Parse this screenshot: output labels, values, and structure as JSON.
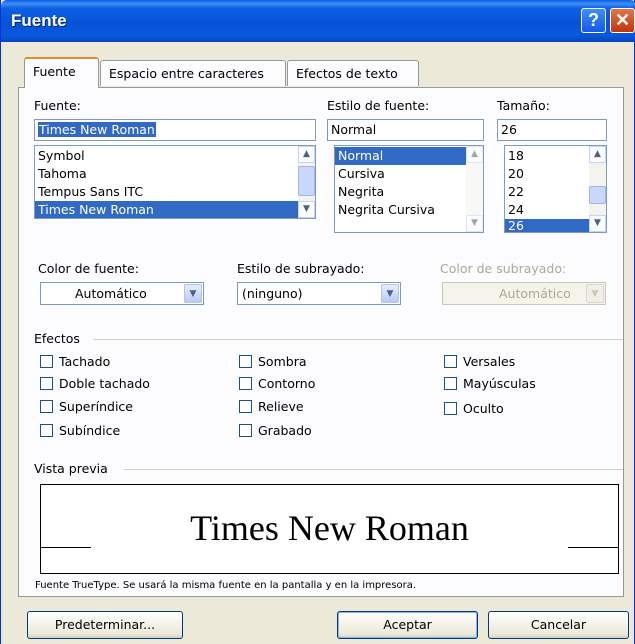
{
  "window": {
    "title": "Fuente",
    "help_glyph": "?",
    "close_glyph": "✕"
  },
  "tabs": [
    {
      "label": "Fuente",
      "selected": true
    },
    {
      "label": "Espacio entre caracteres",
      "selected": false
    },
    {
      "label": "Efectos de texto",
      "selected": false
    }
  ],
  "font": {
    "label": "Fuente:",
    "value": "Times New Roman",
    "items": [
      "Symbol",
      "Tahoma",
      "Tempus Sans ITC",
      "Times New Roman"
    ],
    "selected": "Times New Roman"
  },
  "style": {
    "label": "Estilo de fuente:",
    "value": "Normal",
    "items": [
      "Normal",
      "Cursiva",
      "Negrita",
      "Negrita Cursiva"
    ],
    "selected": "Normal"
  },
  "size": {
    "label": "Tamaño:",
    "value": "26",
    "items": [
      "18",
      "20",
      "22",
      "24",
      "26"
    ],
    "selected": "26"
  },
  "font_color": {
    "label": "Color de fuente:",
    "value": "Automático"
  },
  "underline_style": {
    "label": "Estilo de subrayado:",
    "value": "(ninguno)"
  },
  "underline_color": {
    "label": "Color de subrayado:",
    "value": "Automático",
    "disabled": true
  },
  "effects": {
    "label": "Efectos",
    "col1": [
      "Tachado",
      "Doble tachado",
      "Superíndice",
      "Subíndice"
    ],
    "col2": [
      "Sombra",
      "Contorno",
      "Relieve",
      "Grabado"
    ],
    "col3": [
      "Versales",
      "Mayúsculas",
      "Oculto"
    ]
  },
  "preview": {
    "label": "Vista previa",
    "text": "Times New Roman",
    "note": "Fuente TrueType. Se usará la misma fuente en la pantalla y en la impresora."
  },
  "buttons": {
    "default": "Predeterminar...",
    "ok": "Aceptar",
    "cancel": "Cancelar"
  },
  "colors": {
    "title_bar": "#0653d9",
    "selection": "#316ac5",
    "dialog_bg": "#ece9d8"
  },
  "icons": {
    "scroll_up": "▲",
    "scroll_down": "▼",
    "dropdown": "▼"
  }
}
